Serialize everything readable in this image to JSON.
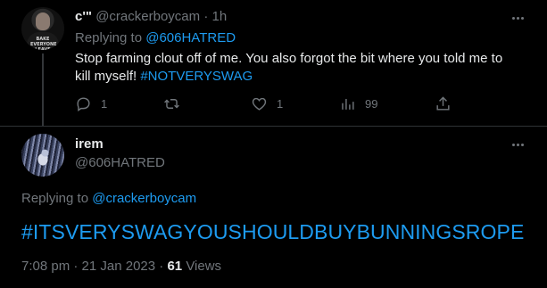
{
  "reply_tweet": {
    "author_name": "c'\"",
    "handle": "@crackerboycam",
    "separator": "·",
    "time": "1h",
    "replying_to_label": "Replying to",
    "replying_to_handle": "@606HATRED",
    "body_text": "Stop farming clout off of me. You also forgot the bit where you told me to kill myself!",
    "body_hashtag": "#NOTVERYSWAG",
    "avatar_shirt_text": "BAKE EVERYONE & LEAVE",
    "actions": {
      "reply_count": "1",
      "retweet_count": "",
      "like_count": "1",
      "views_count": "99"
    }
  },
  "main_tweet": {
    "author_name": "irem",
    "handle": "@606HATRED",
    "replying_to_label": "Replying to",
    "replying_to_handle": "@crackerboycam",
    "body_hashtag": "#ITSVERYSWAGYOUSHOULDBUYBUNNINGSROPE",
    "timestamp": "7:08 pm · 21 Jan 2023",
    "separator": "·",
    "views_count": "61",
    "views_label": "Views"
  },
  "icons": {
    "reply": "reply-icon",
    "retweet": "retweet-icon",
    "like": "heart-icon",
    "views": "views-chart-icon",
    "share": "share-icon",
    "more": "more-icon"
  },
  "colors": {
    "background": "#000000",
    "text_primary": "#e7e9ea",
    "text_secondary": "#71767b",
    "link": "#1d9bf0",
    "divider": "#2f3336"
  }
}
